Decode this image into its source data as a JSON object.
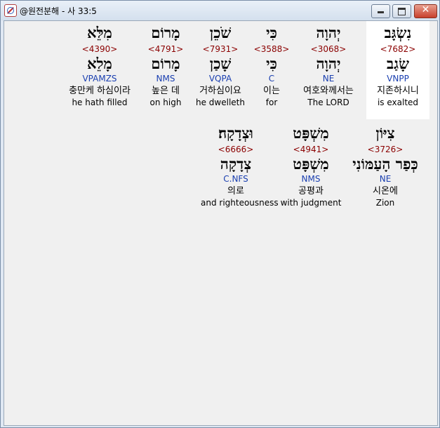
{
  "window": {
    "title": "@원전분해 - 사 33:5"
  },
  "rows": [
    {
      "words": [
        {
          "hebrew": "נִשְׂגָּב",
          "strong": "<7682>",
          "lemma": "שָׂגַב",
          "parse": "VNPP",
          "korean": "지존하시니",
          "english": "is exalted",
          "selected": true
        },
        {
          "hebrew": "יְהוָה",
          "strong": "<3068>",
          "lemma": "יְהוָה",
          "parse": "NE",
          "korean": "여호와께서는",
          "english": "The LORD"
        },
        {
          "hebrew": "כִּי",
          "strong": "<3588>",
          "lemma": "כִּי",
          "parse": "C",
          "korean": "이는",
          "english": "for"
        },
        {
          "hebrew": "שֹׁכֵן",
          "strong": "<7931>",
          "lemma": "שָׁכַן",
          "parse": "VQPA",
          "korean": "거하심이요",
          "english": "he dwelleth"
        },
        {
          "hebrew": "מָרוֹם",
          "strong": "<4791>",
          "lemma": "מָרוֹם",
          "parse": "NMS",
          "korean": "높은 데",
          "english": "on high"
        },
        {
          "hebrew": "מִלֵּא",
          "strong": "<4390>",
          "lemma": "מָלֵא",
          "parse": "VPAMZS",
          "korean": "충만케 하심이라",
          "english": "he hath filled"
        }
      ]
    },
    {
      "words": [
        {
          "hebrew": "צִיּוֹן",
          "strong": "<3726>",
          "lemma": "כְּפַר הָעַמּוֹנִי",
          "parse": "NE",
          "korean": "시온에",
          "english": "Zion"
        },
        {
          "hebrew": "מִשְׁפָּט",
          "strong": "<4941>",
          "lemma": "מִשְׁפָּט",
          "parse": "NMS",
          "korean": "공평과",
          "english": "with judgment"
        },
        {
          "hebrew": "וּצְדָקָה׃",
          "strong": "<6666>",
          "lemma": "צְדָקָה",
          "parse": "C.NFS",
          "korean": "의로",
          "english": "and righteousness"
        }
      ]
    }
  ]
}
